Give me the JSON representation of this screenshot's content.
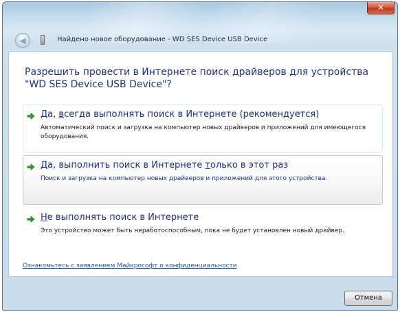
{
  "window": {
    "title": "Найдено новое оборудование - WD SES Device USB Device",
    "close_glyph": "✕"
  },
  "content": {
    "question": "Разрешить провести в Интернете поиск драйверов для устройства \"WD SES Device USB Device\"?",
    "options": [
      {
        "title_pre": "Да, ",
        "title_key": "в",
        "title_post": "сегда выполнять поиск в Интернете (рекомендуется)",
        "description": "Автоматический поиск и загрузка на компьютер новых драйверов и приложений для имеющегося оборудования."
      },
      {
        "title_pre": "Да, выполнить поиск в Интернете ",
        "title_key": "т",
        "title_post": "олько в этот раз",
        "description": "Поиск и загрузка на компьютер новых драйверов и приложений для этого устройства."
      },
      {
        "title_pre": "",
        "title_key": "Н",
        "title_post": "е выполнять поиск в Интернете",
        "description": "Это устройство может быть неработоспособным, пока не будет установлен новый драйвер."
      }
    ],
    "privacy_link": "Ознакомьтесь с заявлением Майкрософт о конфиденциальности"
  },
  "footer": {
    "cancel_label": "Отмена"
  },
  "colors": {
    "accent_text": "#1e3287",
    "arrow_green": "#2e9a2e",
    "link": "#1e55b0"
  },
  "icons": {
    "back": "back-arrow-icon",
    "device": "usb-device-icon",
    "option_arrow": "green-arrow-icon"
  }
}
